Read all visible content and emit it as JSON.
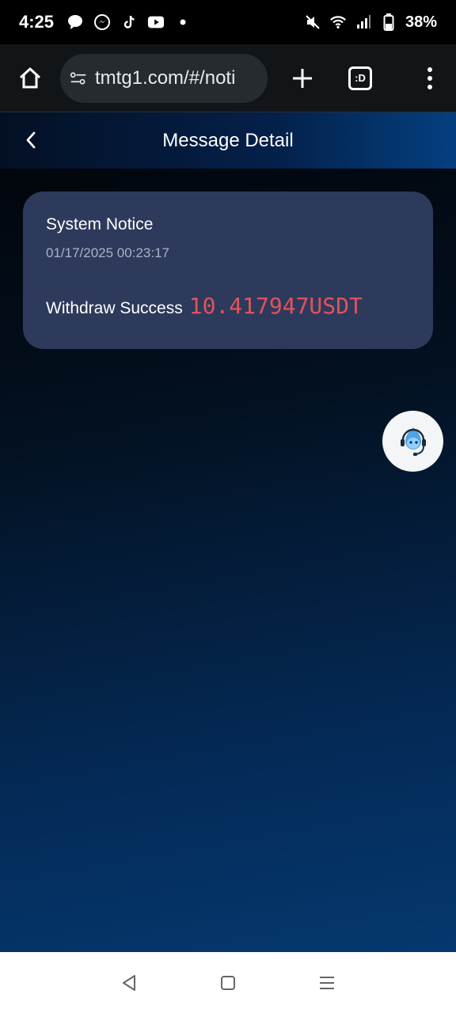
{
  "status_bar": {
    "time": "4:25",
    "battery": "38%",
    "icons_left": [
      "chat-bubble-icon",
      "messenger-icon",
      "tiktok-icon",
      "youtube-icon",
      "dot-icon"
    ],
    "icons_right": [
      "mute-icon",
      "wifi-icon",
      "signal-icon",
      "battery-icon"
    ]
  },
  "browser": {
    "url": "tmtg1.com/#/noti",
    "tabs_label": ":D"
  },
  "header": {
    "title": "Message Detail"
  },
  "message": {
    "title": "System Notice",
    "timestamp": "01/17/2025 00:23:17",
    "body_text": "Withdraw Success",
    "amount": "10.417947USDT"
  },
  "colors": {
    "accent_amount": "#e0535d",
    "card_bg": "#2d3a5c"
  }
}
